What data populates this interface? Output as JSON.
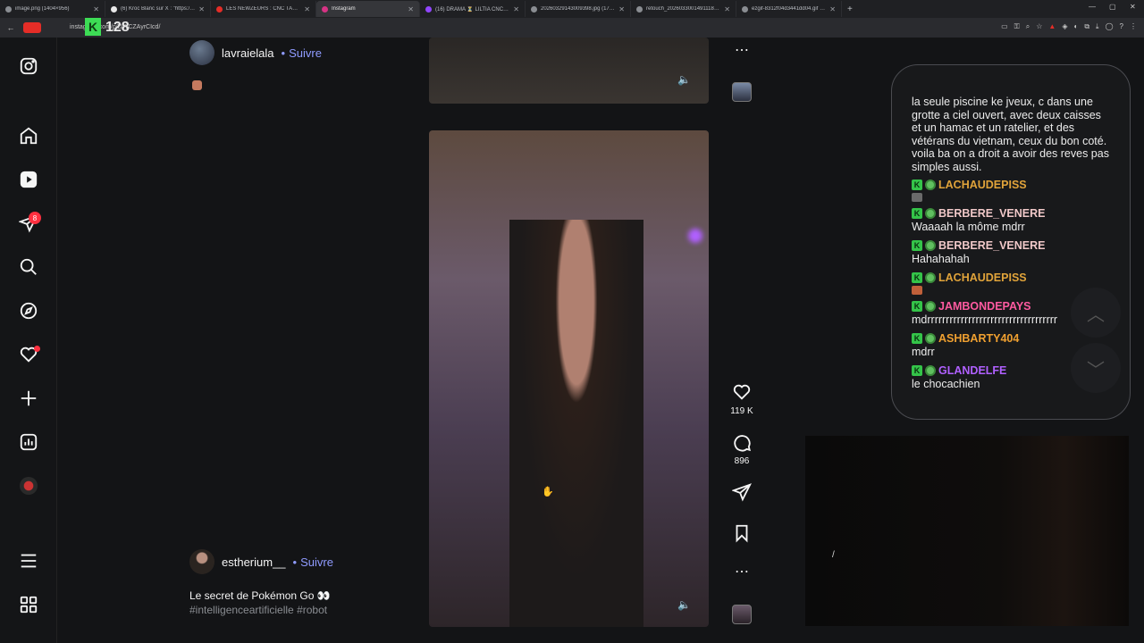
{
  "browser": {
    "tabs": [
      {
        "label": "image.png (1404×956)",
        "color": "#8a8d92"
      },
      {
        "label": "(6) Kroc Blanc sur X : \"https://...",
        "color": "#e8e8e8"
      },
      {
        "label": "LES NEWZEURS : CNC TALENT...",
        "color": "#e52d27"
      },
      {
        "label": "Instagram",
        "color": "#d63384",
        "active": true
      },
      {
        "label": "(16) DRAMA ⏳ LILTIA CNCT!?",
        "color": "#9146ff"
      },
      {
        "label": "20260329143009398.jpg (1736...",
        "color": "#8a8d92"
      },
      {
        "label": "retouch_2026033001491118.jp...",
        "color": "#8a8d92"
      },
      {
        "label": "ezgif-8312f04d3441dd04.gif (2...",
        "color": "#8a8d92"
      }
    ],
    "new_tab": "+",
    "url": "instagram.com/p/DWCZAyrCIcd/",
    "overlay_count": "128",
    "overlay_k": "K"
  },
  "sidebar": {
    "notif_count": "8"
  },
  "feed": {
    "post1": {
      "username": "lavraielala",
      "follow": "Suivre",
      "dot": "•"
    },
    "post2": {
      "username": "estherium__",
      "follow": "Suivre",
      "dot": "•",
      "caption": "Le secret de Pokémon Go 👀",
      "hashtags": "#intelligenceartificielle #robot"
    },
    "likes": "119 K",
    "comments": "896"
  },
  "chat": {
    "top_text": "la seule piscine ke jveux, c dans une grotte a ciel ouvert, avec deux caisses et un hamac et un ratelier, et des vétérans du vietnam, ceux du bon coté. voila ba on a droit a avoir des reves pas simples aussi.",
    "messages": [
      {
        "user": "LACHAUDEPISS",
        "color": "#e0a33a",
        "text": ""
      },
      {
        "user": "BERBERE_VENERE",
        "color": "#f0c8c8",
        "text": "Waaaah la môme mdrr"
      },
      {
        "user": "BERBERE_VENERE",
        "color": "#f0c8c8",
        "text": "Hahahahah"
      },
      {
        "user": "LACHAUDEPISS",
        "color": "#e0a33a",
        "text": ""
      },
      {
        "user": "JAMBONDEPAYS",
        "color": "#ff5aa0",
        "text": "mdrrrrrrrrrrrrrrrrrrrrrrrrrrrrrrrrrrr"
      },
      {
        "user": "ASHBARTY404",
        "color": "#f0a030",
        "text": "mdrr"
      },
      {
        "user": "GLANDELFE",
        "color": "#b060ff",
        "text": "le chocachien"
      }
    ]
  }
}
